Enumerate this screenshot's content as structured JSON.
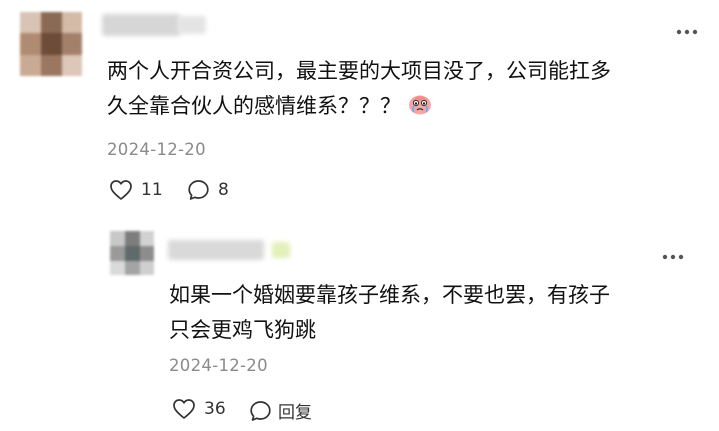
{
  "comment": {
    "text_line1": "两个人开合资公司，最主要的大项目没了，公司能扛多",
    "text_line2": "久全靠合伙人的感情维系？？？",
    "emoji_icon": "crying-face-emoji",
    "date": "2024-12-20",
    "likes": "11",
    "replies": "8",
    "more_icon": "more-dots-icon"
  },
  "reply": {
    "text_line1": "如果一个婚姻要靠孩子维系，不要也罢，有孩子",
    "text_line2": "只会更鸡飞狗跳",
    "date": "2024-12-20",
    "likes": "36",
    "reply_label": "回复",
    "more_icon": "more-dots-icon"
  },
  "colors": {
    "accent_name_blur": "#d8d8d8",
    "date_text": "#8a8a8a",
    "icon_stroke": "#333333"
  }
}
